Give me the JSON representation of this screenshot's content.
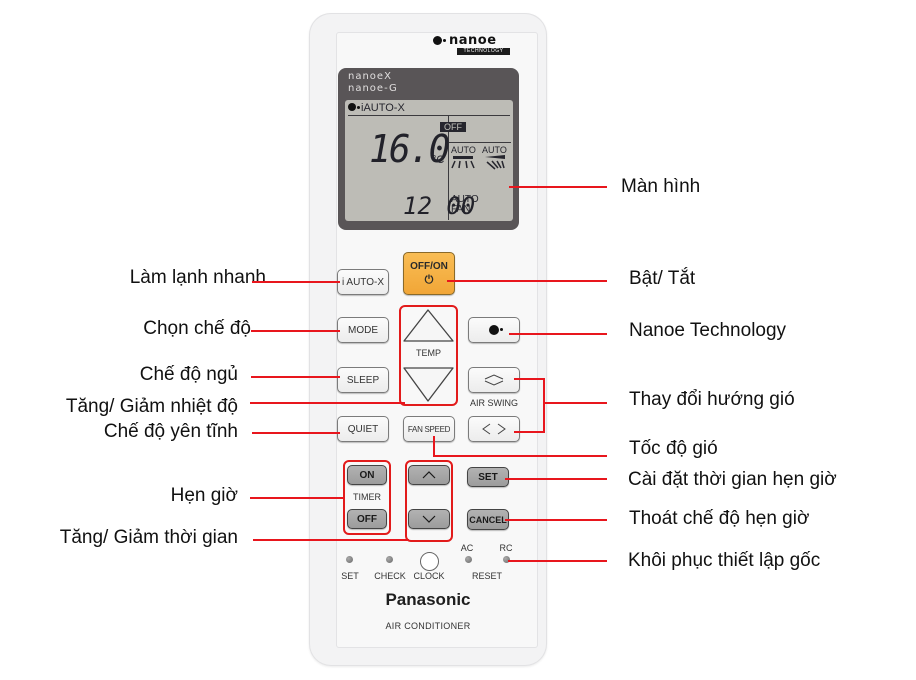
{
  "remote": {
    "nanoe_logo": "nanoe",
    "nanoe_badge": "TECHNOLOGY",
    "display_brand_1": "nanoeX",
    "display_brand_2": "nanoe-G",
    "lcd": {
      "mode": "iAUTO-X",
      "timer_state": "OFF",
      "temperature": "16.0",
      "temp_unit": "°C",
      "fan_direction_vertical": "AUTO",
      "fan_direction_horizontal": "AUTO",
      "clock": "12 00",
      "fan_speed_line1": "AUTO",
      "fan_speed_line2": "FAN"
    },
    "buttons": {
      "iauto_x": "i AUTO-X",
      "off_on": "OFF/ON",
      "power_symbol": "⏻",
      "mode": "MODE",
      "temp": "TEMP",
      "sleep": "SLEEP",
      "air_swing": "AIR SWING",
      "quiet": "QUIET",
      "fan_speed": "FAN SPEED",
      "timer_on": "ON",
      "timer": "TIMER",
      "timer_off": "OFF",
      "set": "SET",
      "cancel": "CANCEL",
      "set_small": "SET",
      "check": "CHECK",
      "clock": "CLOCK",
      "ac": "AC",
      "rc": "RC",
      "reset": "RESET"
    },
    "brand": "Panasonic",
    "product": "AIR CONDITIONER"
  },
  "callouts": {
    "left": [
      "Làm lạnh nhanh",
      "Chọn chế độ",
      "Chế độ ngủ",
      "Tăng/ Giảm nhiệt độ",
      "Chế độ yên tĩnh",
      "Hẹn giờ",
      "Tăng/ Giảm thời gian"
    ],
    "right": [
      "Màn hình",
      "Bật/ Tắt",
      "Nanoe Technology",
      "Thay đổi hướng gió",
      "Tốc độ gió",
      "Cài đặt thời gian hẹn giờ",
      "Thoát chế độ hẹn giờ",
      "Khôi phục thiết lập gốc"
    ]
  },
  "colors": {
    "callout_line": "#e8161d",
    "power_button": "#f4ac3e",
    "lcd_background": "#bdbcb6",
    "display_frame": "#595557"
  }
}
